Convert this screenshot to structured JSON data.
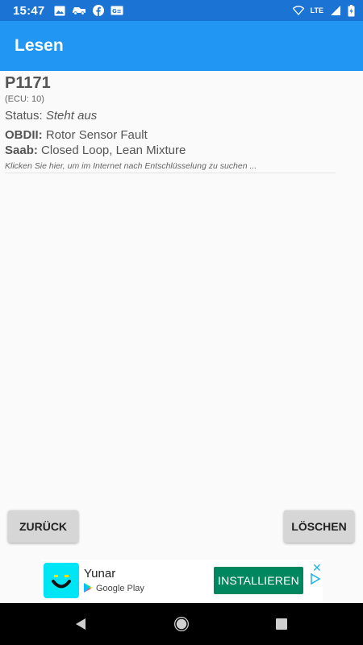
{
  "status_bar": {
    "time": "15:47",
    "left_icons": [
      "image-icon",
      "car-icon",
      "facebook-icon",
      "news-icon"
    ],
    "network": "LTE",
    "right_icons": [
      "wifi-icon",
      "lte-icon",
      "signal-icon",
      "battery-icon"
    ]
  },
  "app_bar": {
    "title": "Lesen"
  },
  "entry": {
    "code": "P1171",
    "ecu": "(ECU: 10)",
    "status_label": "Status:",
    "status_value": "Steht aus",
    "obd_label": "OBDII:",
    "obd_value": "Rotor Sensor Fault",
    "brand_label": "Saab:",
    "brand_value": "Closed Loop, Lean Mixture",
    "search_hint": "Klicken Sie hier, um im Internet nach Entschlüsselung zu suchen ..."
  },
  "buttons": {
    "back": "ZURÜCK",
    "delete": "LÖSCHEN"
  },
  "ad": {
    "app_name": "Yunar",
    "store": "Google Play",
    "install": "INSTALLIEREN",
    "colors": {
      "logo_bg": "#00e5f5",
      "install_bg": "#01875f"
    }
  },
  "colors": {
    "status_bar": "#1b74d4",
    "app_bar": "#2196f3",
    "background": "#fafafa"
  }
}
